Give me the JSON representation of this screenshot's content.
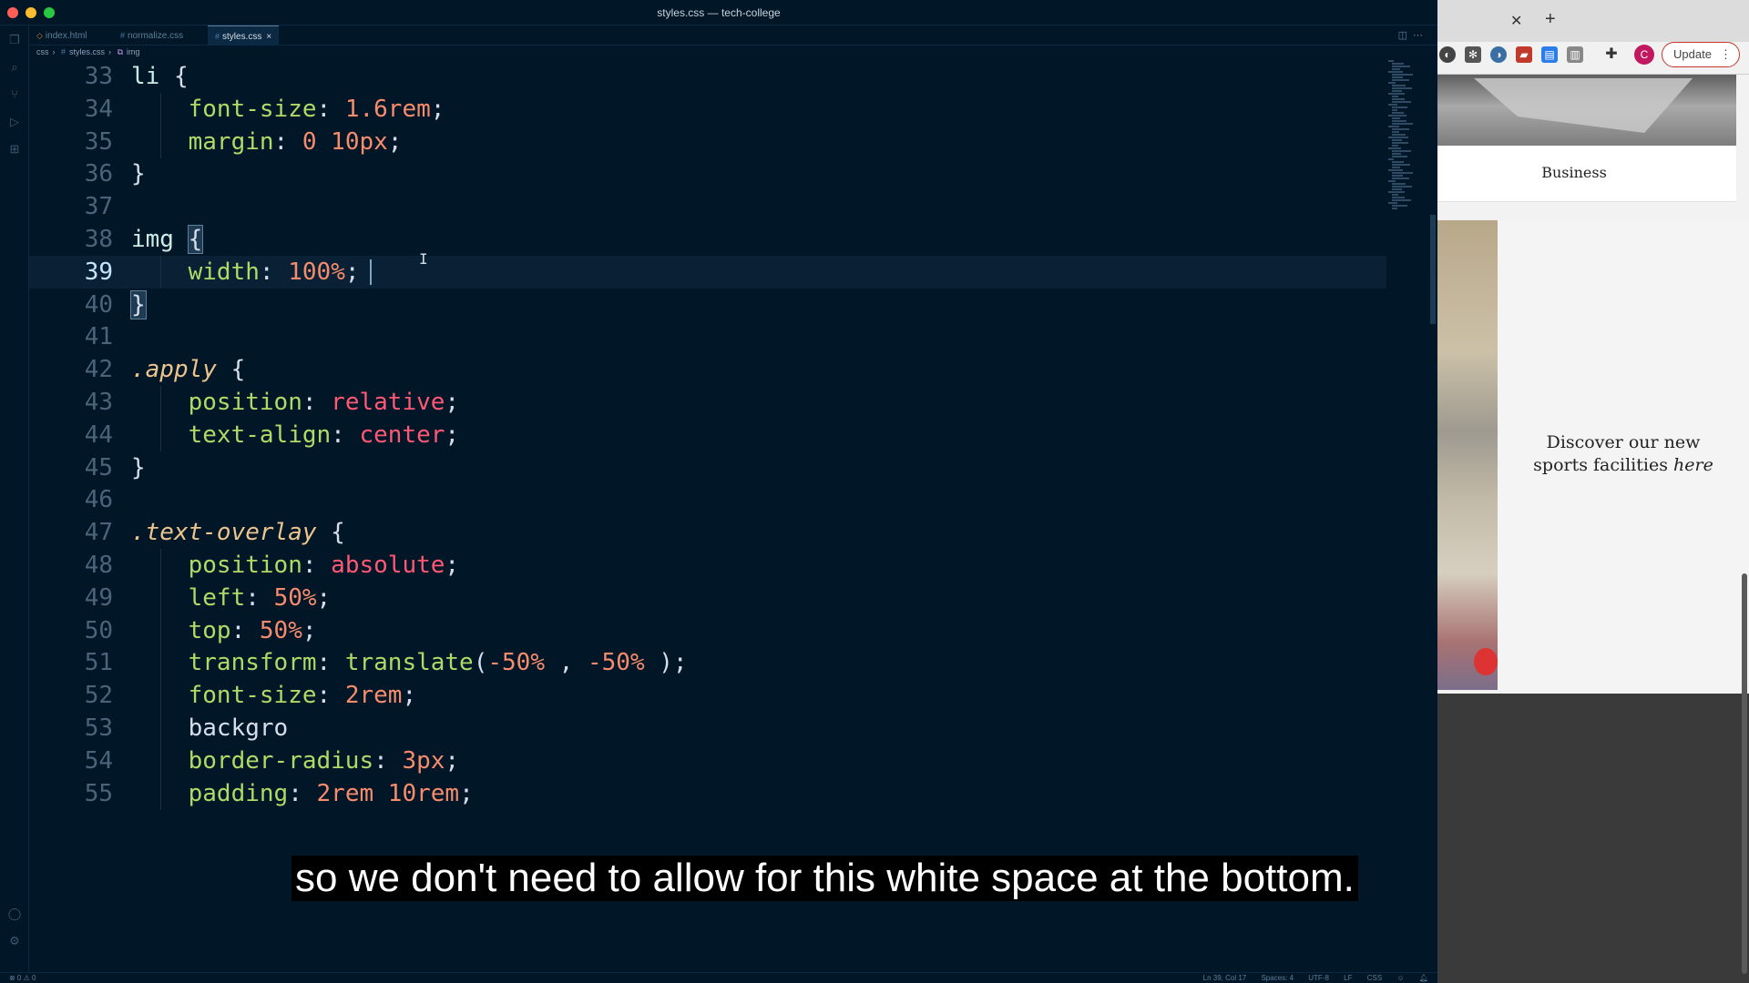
{
  "window": {
    "title": "styles.css — tech-college"
  },
  "tabs": [
    {
      "label": "index.html",
      "icon": "html-icon"
    },
    {
      "label": "normalize.css",
      "icon": "css-icon"
    },
    {
      "label": "styles.css",
      "icon": "css-icon",
      "active": true
    }
  ],
  "breadcrumb": [
    "css",
    "styles.css",
    "img"
  ],
  "editor": {
    "current_line": 39,
    "lines": [
      {
        "n": "33",
        "text": "li {"
      },
      {
        "n": "34",
        "text": "    font-size: 1.6rem;"
      },
      {
        "n": "35",
        "text": "    margin: 0 10px;"
      },
      {
        "n": "36",
        "text": "}"
      },
      {
        "n": "37",
        "text": ""
      },
      {
        "n": "38",
        "text": "img {"
      },
      {
        "n": "39",
        "text": "    width: 100%;"
      },
      {
        "n": "40",
        "text": "}"
      },
      {
        "n": "41",
        "text": ""
      },
      {
        "n": "42",
        "text": ".apply {"
      },
      {
        "n": "43",
        "text": "    position: relative;"
      },
      {
        "n": "44",
        "text": "    text-align: center;"
      },
      {
        "n": "45",
        "text": "}"
      },
      {
        "n": "46",
        "text": ""
      },
      {
        "n": "47",
        "text": ".text-overlay {"
      },
      {
        "n": "48",
        "text": "    position: absolute;"
      },
      {
        "n": "49",
        "text": "    left: 50%;"
      },
      {
        "n": "50",
        "text": "    top: 50%;"
      },
      {
        "n": "51",
        "text": "    transform: translate(-50% , -50% );"
      },
      {
        "n": "52",
        "text": "    font-size: 2rem;"
      },
      {
        "n": "53",
        "text": "    backgro"
      },
      {
        "n": "54",
        "text": "    border-radius: 3px;"
      },
      {
        "n": "55",
        "text": "    padding: 2rem 10rem;"
      }
    ]
  },
  "statusbar": {
    "left": "⊗ 0 ⚠ 0",
    "position": "Ln 39, Col 17",
    "spaces": "Spaces: 4",
    "encoding": "UTF-8",
    "eol": "LF",
    "language": "CSS"
  },
  "subtitle": "so we don't need to allow for this white space at the bottom.",
  "browser": {
    "tab_close": "✕",
    "tab_new": "+",
    "profile_initial": "C",
    "update_label": "Update",
    "page": {
      "card_label": "Business",
      "sports_text_1": "Discover our new",
      "sports_text_2": "sports facilities",
      "sports_text_link": "here"
    }
  },
  "colors": {
    "editor_bg": "#011627",
    "property": "#addb67",
    "number": "#f78c6c",
    "keyword": "#ff5874",
    "selector": "#caece6",
    "class_selector": "#ecc48d",
    "update_border": "#c0392b",
    "profile": "#c1185f"
  }
}
